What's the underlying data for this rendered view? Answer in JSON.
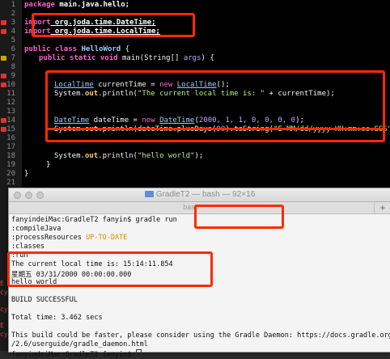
{
  "editor": {
    "line_numbers": [
      "1",
      "2",
      "3",
      "4",
      "5",
      "6",
      "7",
      "8",
      "9",
      "10",
      "11",
      "12",
      "13",
      "14",
      "15",
      "16",
      "17",
      "18",
      "19",
      "20",
      "21"
    ],
    "line1": {
      "kw": "package",
      "rest": " main.java.hello;"
    },
    "line3": {
      "kw": "import",
      "rest": " org.joda.time.DateTime;"
    },
    "line4": {
      "kw": "import",
      "rest": " org.joda.time.LocalTime;"
    },
    "line6": {
      "kw1": "public",
      "kw2": "class",
      "name": "HelloWord",
      "brace": " {"
    },
    "line7": {
      "kw1": "public",
      "kw2": "static",
      "kw3": "void",
      "rest1": " main(String[] ",
      "param": "args",
      "rest2": ") {"
    },
    "line10": {
      "type": "LocalTime",
      "var": " currentTime = ",
      "kw": "new",
      "ctor": "LocalTime",
      "end": "();"
    },
    "line11": {
      "pre": "System.",
      "field": "out",
      "mid": ".println(",
      "str": "\"The current local time is: \"",
      "post": " + currentTime);"
    },
    "line14": {
      "type": "DateTime",
      "var": " dateTime = ",
      "kw": "new",
      "ctor": "DateTime",
      "open": "(",
      "args": "2000, 1, 1, 0, 0, 0, 0",
      "end": ");"
    },
    "line15": {
      "pre": "System.",
      "field": "out",
      "mid": ".println(dateTime.plusDays(",
      "num": "90",
      "mid2": ").toString(",
      "str": "\"E MM/dd/yyyy HH:mm:ss.SSS\"",
      "post": "));"
    },
    "line18": {
      "pre": "System.",
      "field": "out",
      "mid": ".println(",
      "str": "\"hello world\"",
      "post": ");"
    },
    "line19": "}",
    "line20": "}",
    "side_fragments": [
      "E",
      "cy",
      "cy",
      "E",
      "cy"
    ]
  },
  "terminal": {
    "title": "GradleT2 — bash — 92×16",
    "tab_label": "bash",
    "new_tab": "+",
    "lines": [
      "fanyindeiMac:GradleT2 fanyin$ gradle run",
      ":compileJava",
      ":processResources ",
      ":classes",
      ":run",
      "The current local time is: 15:14:11.854",
      "星期五 03/31/2000 00:00:00.000",
      "hello world",
      "",
      "BUILD SUCCESSFUL",
      "",
      "Total time: 3.462 secs",
      "",
      "This build could be faster, please consider using the Gradle Daemon: https://docs.gradle.org",
      "/2.6/userguide/gradle_daemon.html",
      "fanyindeiMac:GradleT2 fanyin$ "
    ],
    "up_to_date": "UP-TO-DATE"
  }
}
